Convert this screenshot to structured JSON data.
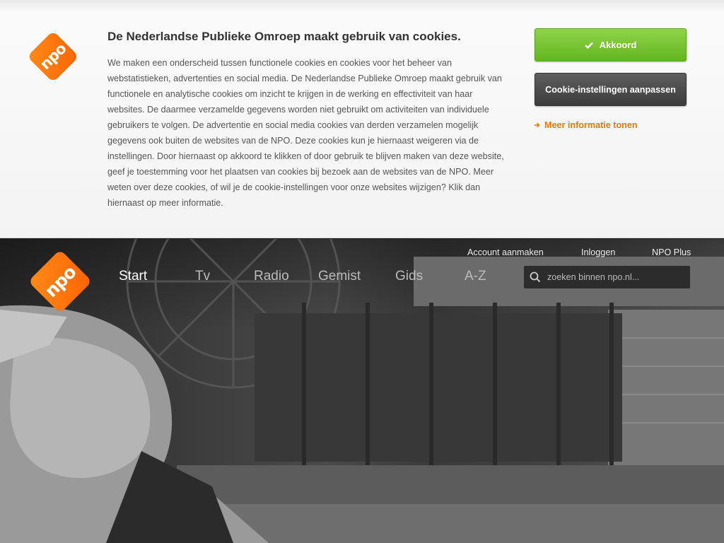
{
  "cookie_banner": {
    "logo_text": "npo",
    "title": "De Nederlandse Publieke Omroep maakt gebruik van cookies.",
    "body": "We maken een onderscheid tussen functionele cookies en cookies voor het beheer van webstatistieken, advertenties en social media. De Nederlandse Publieke Omroep maakt gebruik van functionele en analytische cookies om inzicht te krijgen in de werking en effectiviteit van haar websites. De daarmee verzamelde gegevens worden niet gebruikt om activiteiten van individuele gebruikers te volgen. De advertentie en social media cookies van derden verzamelen mogelijk gegevens ook buiten de websites van de NPO. Deze cookies kun je hiernaast weigeren via de instellingen. Door hiernaast op akkoord te klikken of door gebruik te blijven maken van deze website, geef je toestemming voor het plaatsen van cookies bij bezoek aan de websites van de NPO. Meer weten over deze cookies, of wil je de cookie-instellingen voor onze websites wijzigen? Klik dan hiernaast op meer informatie.",
    "accept_label": "Akkoord",
    "settings_label": "Cookie-instellingen aanpassen",
    "more_info_label": "Meer informatie tonen",
    "accent_color": "#f07800",
    "accept_color": "#6fbf2a"
  },
  "header": {
    "logo_text": "npo",
    "nav": [
      "Start",
      "Tv",
      "Radio",
      "Gemist",
      "Gids",
      "A-Z"
    ],
    "active_nav": "Start",
    "top_links": [
      "Account aanmaken",
      "Inloggen",
      "NPO Plus"
    ],
    "search": {
      "placeholder": "zoeken binnen npo.nl..."
    },
    "icons": {
      "search": "search-icon",
      "accept": "check-icon",
      "more_info": "arrow-right-icon"
    }
  }
}
